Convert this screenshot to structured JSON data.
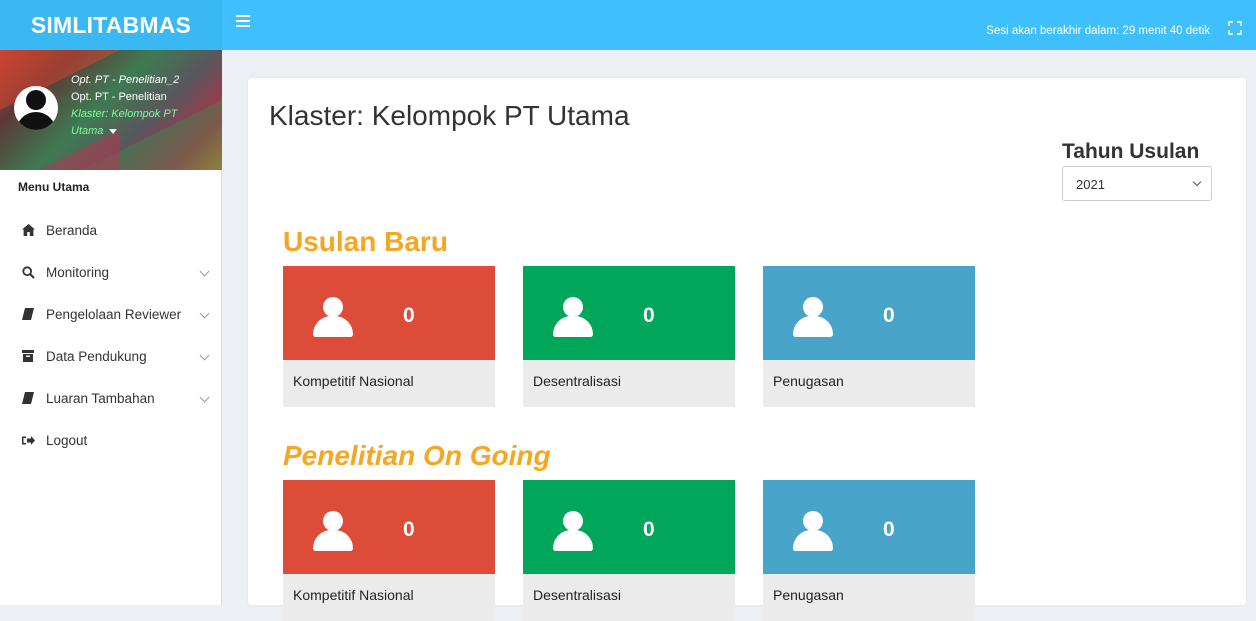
{
  "header": {
    "logo": "SIMLITABMAS",
    "session_text": "Sesi akan berakhir dalam: 29 menit 40 detik"
  },
  "user": {
    "line1": "Opt. PT - Penelitian_2",
    "line2": "Opt. PT - Penelitian",
    "line3": "Klaster: Kelompok PT",
    "line4": "Utama"
  },
  "sidebar": {
    "header": "Menu Utama",
    "items": [
      {
        "label": "Beranda",
        "icon": "home-icon"
      },
      {
        "label": "Monitoring",
        "icon": "search-icon"
      },
      {
        "label": "Pengelolaan Reviewer",
        "icon": "book-icon"
      },
      {
        "label": "Data Pendukung",
        "icon": "archive-icon"
      },
      {
        "label": "Luaran Tambahan",
        "icon": "book-icon"
      },
      {
        "label": "Logout",
        "icon": "sign-out-icon"
      }
    ]
  },
  "main": {
    "title": "Klaster: Kelompok PT Utama",
    "tahun_label": "Tahun Usulan",
    "tahun_value": "2021",
    "sections": [
      {
        "title": "Usulan Baru",
        "cards": [
          {
            "value": "0",
            "label": "Kompetitif Nasional",
            "color": "#dd4b39"
          },
          {
            "value": "0",
            "label": "Desentralisasi",
            "color": "#00a65a"
          },
          {
            "value": "0",
            "label": "Penugasan",
            "color": "#48a4c9"
          }
        ]
      },
      {
        "title": "Penelitian On Going",
        "cards": [
          {
            "value": "0",
            "label": "Kompetitif Nasional",
            "color": "#dd4b39"
          },
          {
            "value": "0",
            "label": "Desentralisasi",
            "color": "#00a65a"
          },
          {
            "value": "0",
            "label": "Penugasan",
            "color": "#48a4c9"
          }
        ]
      }
    ]
  },
  "colors": {
    "topbar": "#3fc0fc",
    "accent_title": "#f5a623"
  }
}
